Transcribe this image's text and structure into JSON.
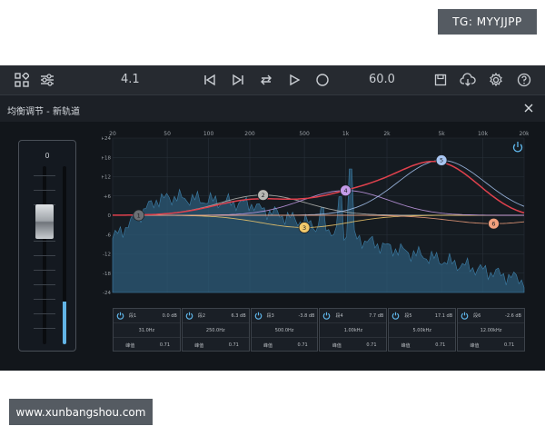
{
  "watermarks": {
    "top": "TG: MYYJJPP",
    "bottom": "www.xunbangshou.com"
  },
  "toolbar": {
    "icons": [
      "grid-icon",
      "sliders-icon",
      "skip-back-icon",
      "skip-forward-icon",
      "repeat-icon",
      "play-icon",
      "record-icon",
      "save-icon",
      "cloud-download-icon",
      "gear-icon",
      "help-icon"
    ],
    "left_value": "4.1",
    "right_value": "60.0"
  },
  "window": {
    "title": "均衡调节 - 新轨道"
  },
  "fader": {
    "value": "0",
    "meter_level": 0.24
  },
  "graph": {
    "x_ticks": [
      "20",
      "50",
      "100",
      "200",
      "500",
      "1k",
      "2k",
      "5k",
      "10k",
      "20k"
    ],
    "y_ticks": [
      "+24",
      "+18",
      "+12",
      "+6",
      "0",
      "-6",
      "-12",
      "-18",
      "-24"
    ],
    "bands_on_graph": [
      {
        "id": "1",
        "color": "#6b6f74"
      },
      {
        "id": "2",
        "color": "#b8b9b4"
      },
      {
        "id": "3",
        "color": "#f2c96b"
      },
      {
        "id": "4",
        "color": "#c49be8"
      },
      {
        "id": "5",
        "color": "#a8c6f2"
      },
      {
        "id": "6",
        "color": "#f2a07d"
      }
    ]
  },
  "chart_data": {
    "type": "line",
    "xlabel": "",
    "ylabel": "",
    "x_scale": "log",
    "xlim": [
      20,
      20000
    ],
    "ylim": [
      -24,
      24
    ],
    "grid": true,
    "series": [
      {
        "x": [
          20,
          31,
          60,
          120,
          250,
          500,
          1000,
          2000,
          5000,
          10000,
          12000,
          20000
        ],
        "y": [
          0,
          0,
          0.6,
          2.8,
          6.3,
          3.5,
          7.2,
          6.5,
          17.1,
          6,
          -2.6,
          0
        ]
      }
    ],
    "points": [
      {
        "label": "1",
        "x": 31,
        "y": 0
      },
      {
        "label": "2",
        "x": 250,
        "y": 6.3
      },
      {
        "label": "3",
        "x": 500,
        "y": -3.8
      },
      {
        "label": "4",
        "x": 1000,
        "y": 7.7
      },
      {
        "label": "5",
        "x": 5000,
        "y": 17.1
      },
      {
        "label": "6",
        "x": 12000,
        "y": -2.6
      }
    ]
  },
  "bands": [
    {
      "name": "段1",
      "gain": "0.0 dB",
      "freq": "31.0Hz",
      "q_label": "峰值",
      "q": "0.71"
    },
    {
      "name": "段2",
      "gain": "6.3 dB",
      "freq": "250.0Hz",
      "q_label": "峰值",
      "q": "0.71"
    },
    {
      "name": "段3",
      "gain": "-3.8 dB",
      "freq": "500.0Hz",
      "q_label": "峰值",
      "q": "0.71"
    },
    {
      "name": "段4",
      "gain": "7.7 dB",
      "freq": "1.00kHz",
      "q_label": "峰值",
      "q": "0.71"
    },
    {
      "name": "段5",
      "gain": "17.1 dB",
      "freq": "5.00kHz",
      "q_label": "峰值",
      "q": "0.71"
    },
    {
      "name": "段6",
      "gain": "-2.6 dB",
      "freq": "12.00kHz",
      "q_label": "峰值",
      "q": "0.71"
    }
  ]
}
